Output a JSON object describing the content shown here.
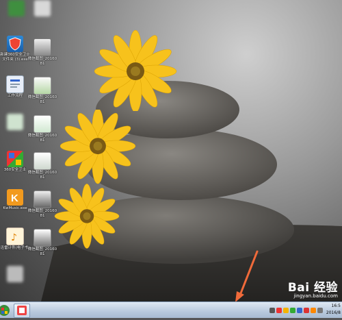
{
  "desktop": {
    "icons": [
      {
        "label": "",
        "blurred": true
      },
      {
        "label": "",
        "blurred": true
      },
      {
        "label": "新建360安全卫士文件夹 (3).exe"
      },
      {
        "label": "微信截图_2016081"
      },
      {
        "label": "工作流程"
      },
      {
        "label": "微信截图_2016081"
      },
      {
        "label": "",
        "blurred": true
      },
      {
        "label": "微信截图_2016081"
      },
      {
        "label": "360安全卫士"
      },
      {
        "label": "微信截图_2016081"
      },
      {
        "label": "KwMusic.exe"
      },
      {
        "label": "微信截图_2016081"
      },
      {
        "label": "迅雷计件(电子书)"
      },
      {
        "label": "微信截图_2016081"
      },
      {
        "label": "",
        "blurred": true
      }
    ]
  },
  "watermark": {
    "brand": "Bai 经验",
    "url": "jingyan.baidu.com"
  },
  "taskbar": {
    "clock_time": "16:5",
    "clock_date": "2016/8"
  },
  "colors": {
    "arrow": "#f06a3a",
    "flower": "#f7c21c",
    "flower_center": "#7a5a14"
  }
}
